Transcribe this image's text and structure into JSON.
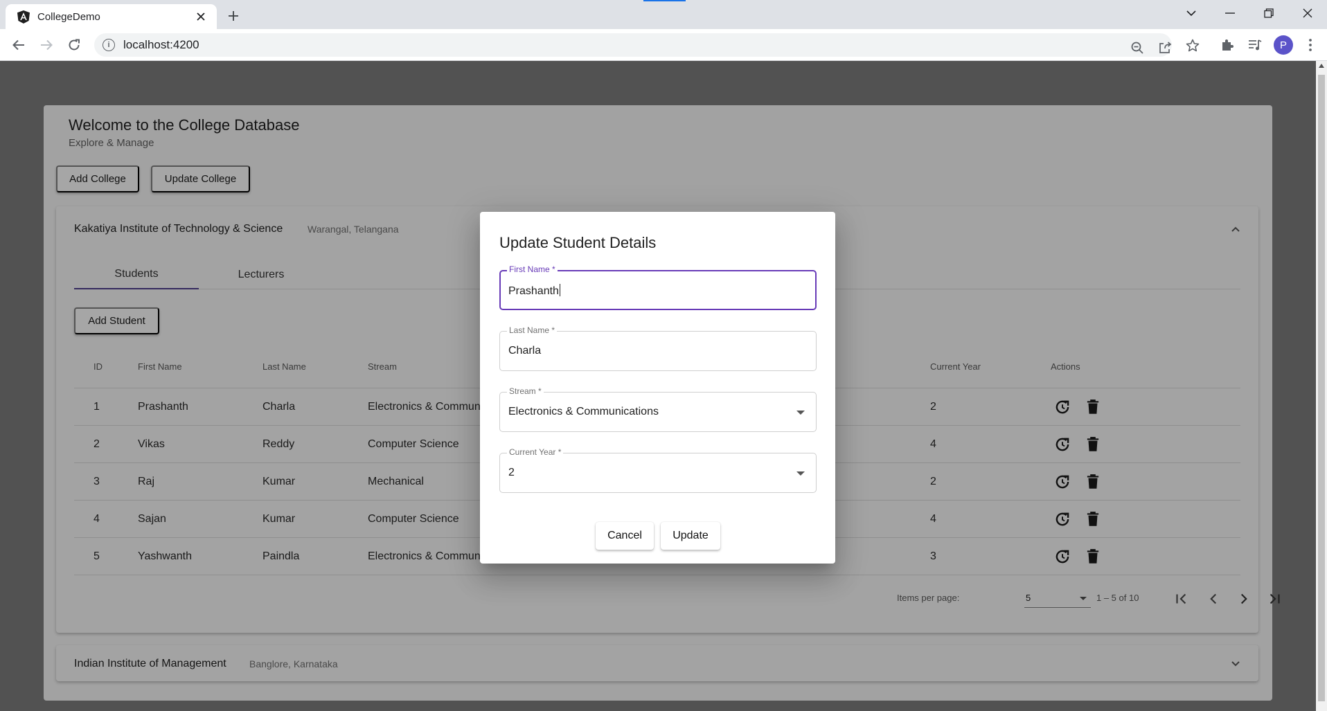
{
  "browser": {
    "tab_title": "CollegeDemo",
    "url": "localhost:4200",
    "avatar_letter": "P"
  },
  "app": {
    "title": "Welcome to the College Database",
    "subtitle": "Explore & Manage",
    "add_college_label": "Add College",
    "update_college_label": "Update College"
  },
  "college1": {
    "name": "Kakatiya Institute of Technology & Science",
    "location": "Warangal, Telangana",
    "tabs": [
      {
        "label": "Students"
      },
      {
        "label": "Lecturers"
      }
    ],
    "add_student_label": "Add Student",
    "columns": {
      "id": "ID",
      "first_name": "First Name",
      "last_name": "Last Name",
      "stream": "Stream",
      "current_year": "Current Year",
      "actions": "Actions"
    },
    "rows": [
      {
        "id": "1",
        "first_name": "Prashanth",
        "last_name": "Charla",
        "stream": "Electronics & Communications",
        "year": "2"
      },
      {
        "id": "2",
        "first_name": "Vikas",
        "last_name": "Reddy",
        "stream": "Computer Science",
        "year": "4"
      },
      {
        "id": "3",
        "first_name": "Raj",
        "last_name": "Kumar",
        "stream": "Mechanical",
        "year": "2"
      },
      {
        "id": "4",
        "first_name": "Sajan",
        "last_name": "Kumar",
        "stream": "Computer Science",
        "year": "4"
      },
      {
        "id": "5",
        "first_name": "Yashwanth",
        "last_name": "Paindla",
        "stream": "Electronics & Communications",
        "year": "3"
      }
    ],
    "paginator": {
      "items_per_page_label": "Items per page:",
      "page_size": "5",
      "range_label": "1 – 5 of 10"
    }
  },
  "college2": {
    "name": "Indian Institute of Management",
    "location": "Banglore, Karnataka"
  },
  "dialog": {
    "title": "Update Student Details",
    "first_name": {
      "label": "First Name *",
      "value": "Prashanth"
    },
    "last_name": {
      "label": "Last Name *",
      "value": "Charla"
    },
    "stream": {
      "label": "Stream *",
      "value": "Electronics & Communications"
    },
    "current_year": {
      "label": "Current Year *",
      "value": "2"
    },
    "cancel_label": "Cancel",
    "update_label": "Update"
  },
  "colors": {
    "accent": "#673ab7",
    "overlay": "#525252"
  }
}
